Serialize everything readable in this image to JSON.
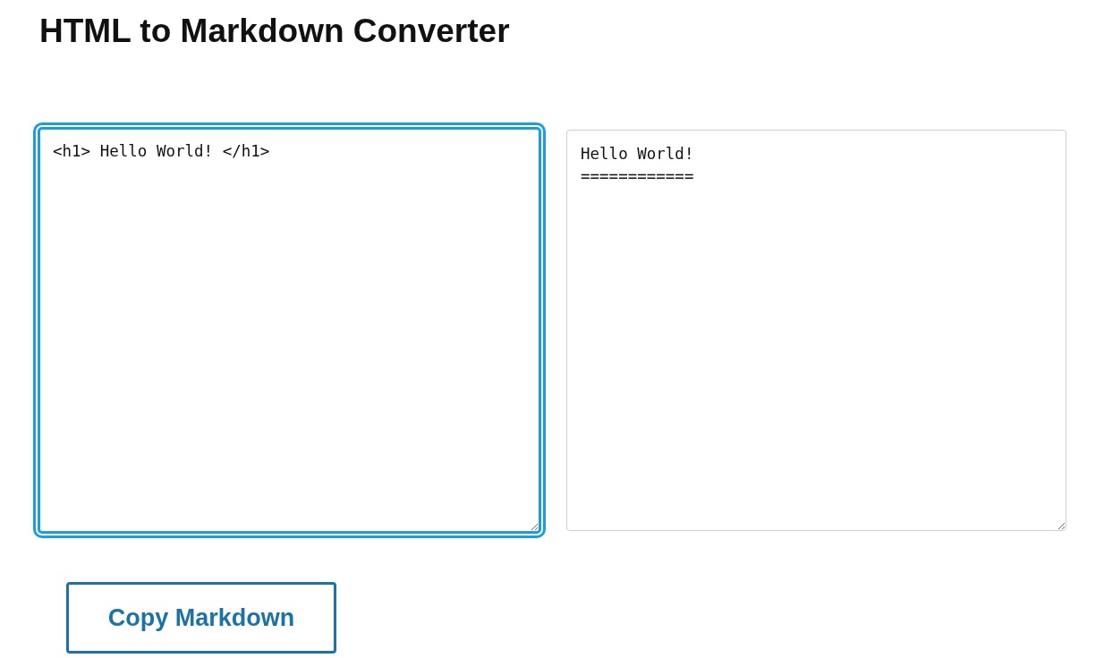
{
  "page": {
    "title": "HTML to Markdown Converter"
  },
  "input_box": {
    "value": "<h1> Hello World! </h1>",
    "focused": true
  },
  "output_box": {
    "value": "Hello World!\n============",
    "focused": false
  },
  "copy_button": {
    "label": "Copy Markdown"
  }
}
